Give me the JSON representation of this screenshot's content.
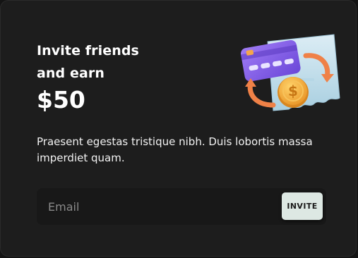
{
  "card": {
    "heading_line1": "Invite friends",
    "heading_line2": "and earn",
    "amount": "$50",
    "description": "Praesent egestas tristique nibh. Duis lobortis massa imperdiet quam.",
    "email_placeholder": "Email",
    "email_value": "",
    "invite_label": "INVITE",
    "illustration_icon": "credit-card-coin-exchange-icon"
  },
  "colors": {
    "background": "#1d1d1d",
    "input_background": "#181818",
    "button_background": "#dde8e3",
    "card_purple": "#7c5ce6",
    "coin_gold": "#f2a93b",
    "arrow_orange": "#ef8147",
    "receipt_blue": "#cfe6f0"
  }
}
